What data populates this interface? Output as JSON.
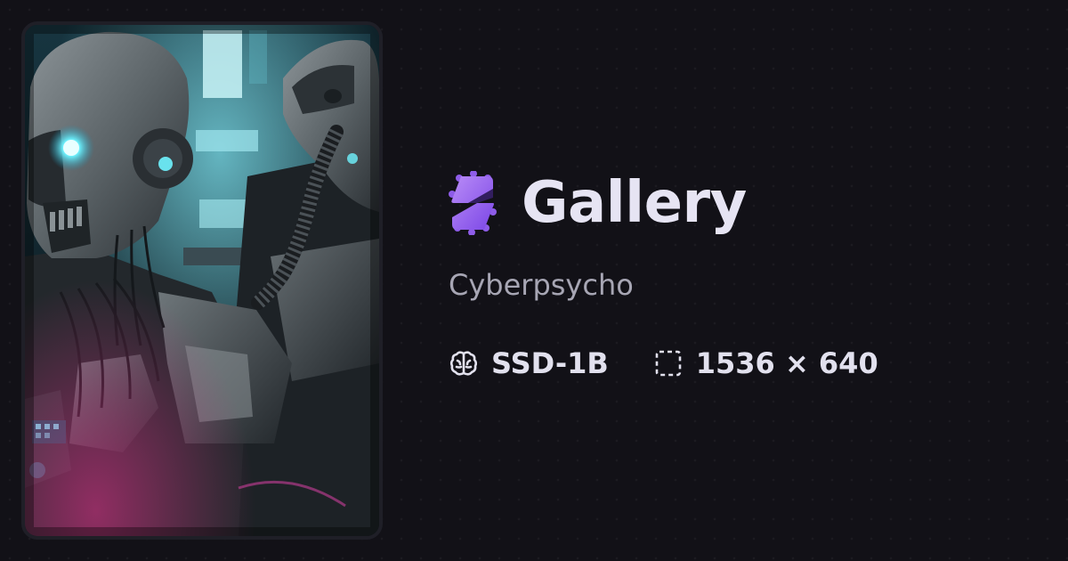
{
  "gallery": {
    "title": "Gallery",
    "logo_icon": "stable-diffusion-logo-icon",
    "accent_color": "#9b6cf0"
  },
  "image": {
    "title": "Cyberpsycho",
    "model_icon": "brain-icon",
    "model": "SSD-1B",
    "dimensions_icon": "dashed-frame-icon",
    "dimensions": "1536 × 640"
  },
  "theme": {
    "background": "#121117",
    "text_primary": "#e6e4f3",
    "text_secondary": "#a7a6b4"
  }
}
